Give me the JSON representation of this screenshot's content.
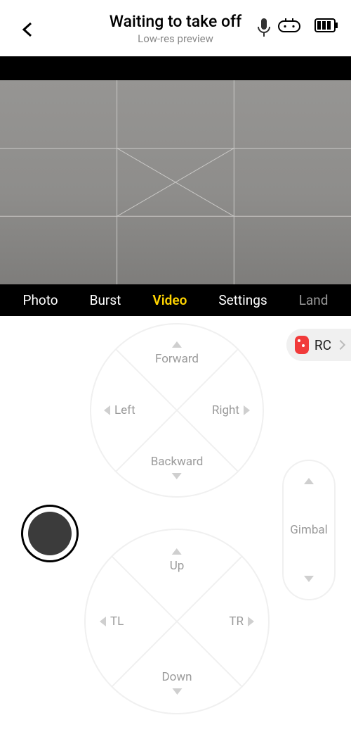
{
  "header": {
    "title": "Waiting to take off",
    "subtitle": "Low-res preview"
  },
  "camTabs": {
    "photo": "Photo",
    "burst": "Burst",
    "video": "Video",
    "settings": "Settings",
    "land": "Land",
    "active": "video"
  },
  "rc": {
    "label": "RC"
  },
  "dpad1": {
    "forward": "Forward",
    "backward": "Backward",
    "left": "Left",
    "right": "Right"
  },
  "dpad2": {
    "up": "Up",
    "down": "Down",
    "tl": "TL",
    "tr": "TR"
  },
  "gimbal": {
    "label": "Gimbal"
  }
}
